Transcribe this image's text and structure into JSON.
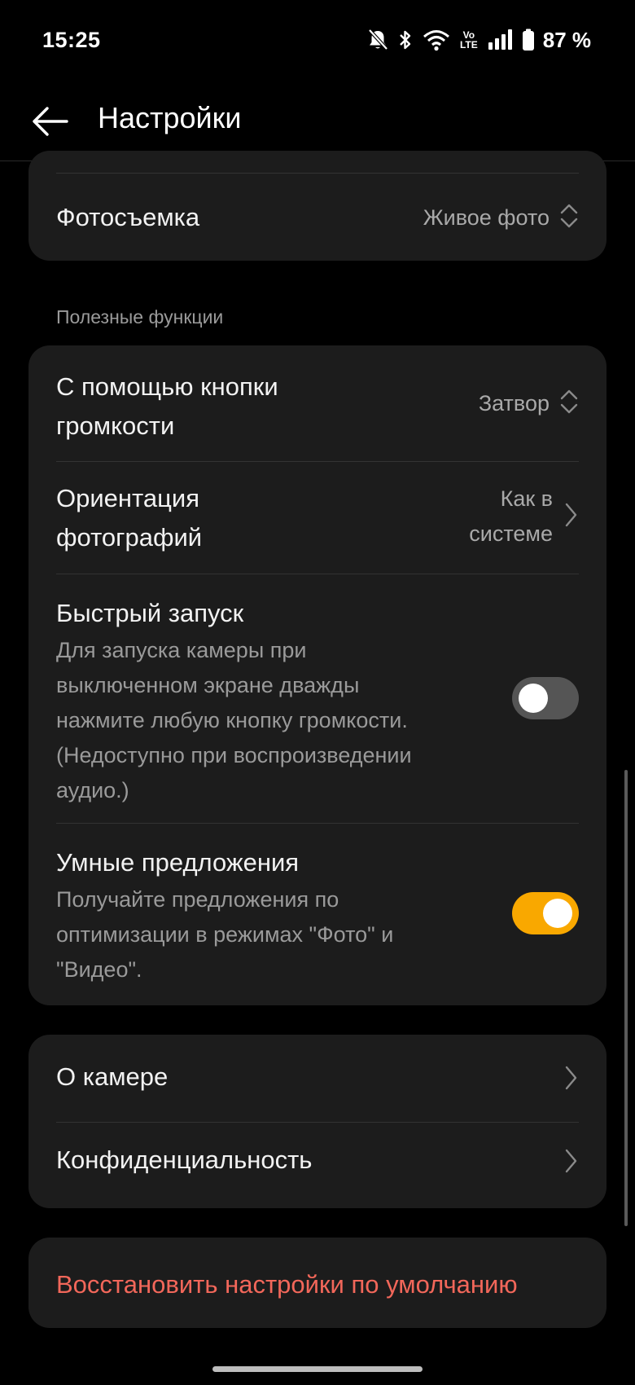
{
  "status_bar": {
    "time": "15:25",
    "volte_top": "Vo",
    "volte_bottom": "LTE",
    "battery": "87 %",
    "icons": [
      "bell-muted-icon",
      "bluetooth-icon",
      "wifi-icon",
      "volte-icon",
      "signal-icon",
      "battery-icon"
    ]
  },
  "app_bar": {
    "title": "Настройки",
    "back_icon": "arrow-left-icon"
  },
  "capture": {
    "label": "Фотосъемка",
    "value": "Живое фото"
  },
  "useful_section": {
    "header": "Полезные функции",
    "volume_button": {
      "label_line1": "С помощью кнопки",
      "label_line2": "громкости",
      "value": "Затвор"
    },
    "photo_orientation": {
      "label_line1": "Ориентация",
      "label_line2": "фотографий",
      "value_line1": "Как в",
      "value_line2": "системе"
    },
    "quick_launch": {
      "label": "Быстрый запуск",
      "desc_line1": "Для запуска камеры при",
      "desc_line2": "выключенном экране дважды",
      "desc_line3": "нажмите любую кнопку громкости.",
      "desc_line4": "(Недоступно при воспроизведении",
      "desc_line5": "аудио.)",
      "enabled": false
    },
    "smart_suggestions": {
      "label": "Умные предложения",
      "desc_line1": "Получайте предложения по",
      "desc_line2": "оптимизации в режимах \"Фото\" и",
      "desc_line3": "\"Видео\".",
      "enabled": true
    }
  },
  "about_section": {
    "about_camera": "О камере",
    "privacy": "Конфиденциальность"
  },
  "reset": {
    "label": "Восстановить настройки по умолчанию"
  },
  "colors": {
    "background": "#000000",
    "card": "#1c1c1c",
    "accent_toggle": "#f9a800",
    "reset_text": "#f2675a"
  }
}
